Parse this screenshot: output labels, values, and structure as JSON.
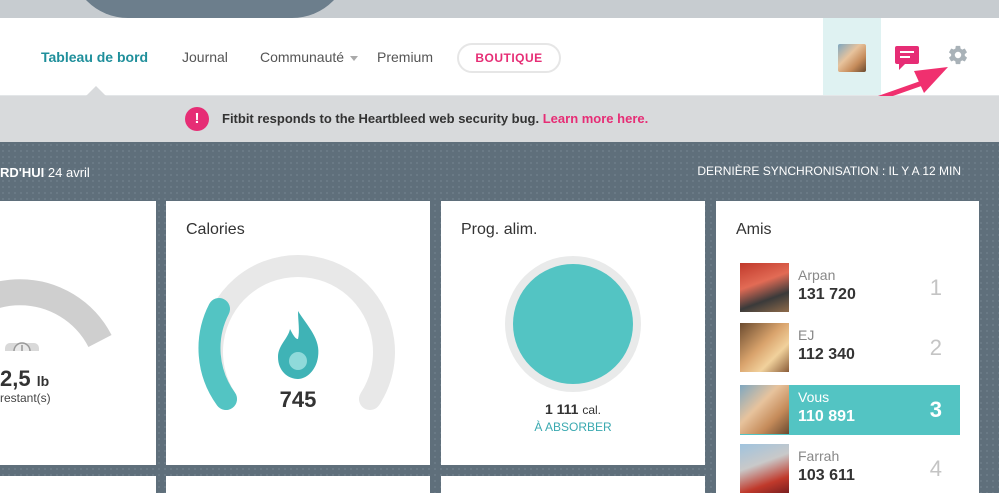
{
  "nav": {
    "items": [
      "Tableau de bord",
      "Journal",
      "Communauté",
      "Premium"
    ],
    "boutique": "BOUTIQUE"
  },
  "alert": {
    "icon": "!",
    "text": "Fitbit responds to the Heartbleed web security bug.",
    "link": "Learn more here."
  },
  "dashboard": {
    "today_label": "RD'HUI",
    "today_date": "24 avril",
    "sync_text": "DERNIÈRE SYNCHRONISATION : IL Y A 12 MIN"
  },
  "weight": {
    "value": "2,5",
    "unit": "lb",
    "sub": "restant(s)"
  },
  "calories": {
    "title": "Calories",
    "value": "745",
    "progress": 0.2
  },
  "food": {
    "title": "Prog. alim.",
    "value": "1 111",
    "unit": "cal.",
    "sub": "À ABSORBER"
  },
  "friends": {
    "title": "Amis",
    "list": [
      {
        "name": "Arpan",
        "steps": "131 720",
        "rank": "1"
      },
      {
        "name": "EJ",
        "steps": "112 340",
        "rank": "2"
      },
      {
        "name": "Vous",
        "steps": "110 891",
        "rank": "3"
      },
      {
        "name": "Farrah",
        "steps": "103 611",
        "rank": "4"
      }
    ]
  },
  "colors": {
    "accent_teal": "#53c4c3",
    "accent_pink": "#e62d75",
    "background": "#5f6f7b"
  },
  "icons": [
    "avatar",
    "message-icon",
    "gear-icon",
    "alert-icon",
    "flame-icon",
    "scale-icon"
  ]
}
